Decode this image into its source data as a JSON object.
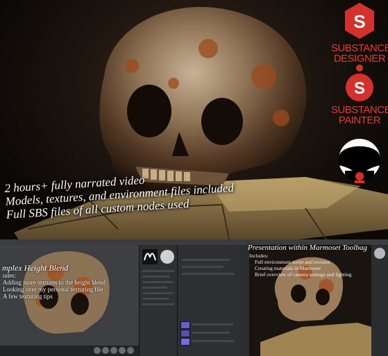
{
  "hero": {
    "title_fragment": "",
    "bullets": [
      "2 hours+ fully narrated video",
      "Models, textures, and environment files included",
      "Full SBS files of all custom nodes used"
    ]
  },
  "logos": {
    "designer": {
      "line1": "SUBSTANCE",
      "line2": "DESIGNER",
      "icon": "substance-designer-icon"
    },
    "painter": {
      "line1": "SUBSTANCE",
      "line2": "PAINTER",
      "icon": "substance-painter-icon"
    },
    "avatar": {
      "icon": "artist-avatar-icon"
    }
  },
  "screenshot_left": {
    "title": "mplex Height Blend",
    "notes": [
      "udes:",
      "Adding more textures to the height blend",
      "Looking over my personal texturing file",
      "A few texturing tips"
    ]
  },
  "screenshot_right": {
    "title": "Presentation within Marmoset Toolbag",
    "notes": [
      "Includes:",
      "Full environment scene and textures",
      "Creating materials in Marmoset",
      "Brief overview of camera settings and lighting"
    ]
  },
  "colors": {
    "substance_red": "#d5312c",
    "background": "#0c0907",
    "ui_dark": "#28292b"
  }
}
